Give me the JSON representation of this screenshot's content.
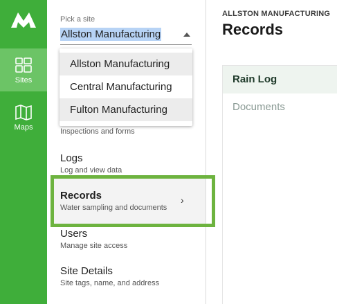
{
  "rail": {
    "logo": "brand-mountain-logo",
    "items": [
      {
        "label": "Sites",
        "icon": "grid-icon",
        "active": true
      },
      {
        "label": "Maps",
        "icon": "map-icon",
        "active": false
      }
    ]
  },
  "site_picker": {
    "label": "Pick a site",
    "selected": "Allston Manufacturing",
    "options": [
      "Allston Manufacturing",
      "Central Manufacturing",
      "Fulton Manufacturing"
    ]
  },
  "menu": [
    {
      "title": "",
      "subtitle": "Inspections and forms"
    },
    {
      "title": "Logs",
      "subtitle": "Log and view data"
    },
    {
      "title": "Records",
      "subtitle": "Water sampling and documents"
    },
    {
      "title": "Users",
      "subtitle": "Manage site access"
    },
    {
      "title": "Site Details",
      "subtitle": "Site tags, name, and address"
    }
  ],
  "header": {
    "breadcrumb": "ALLSTON MANUFACTURING",
    "title": "Records"
  },
  "tabs": [
    {
      "label": "Rain Log",
      "active": true
    },
    {
      "label": "Documents",
      "active": false
    }
  ],
  "colors": {
    "brand_green": "#3fae3a",
    "rail_active": "#6cc466",
    "highlight_border": "#6db33f"
  }
}
